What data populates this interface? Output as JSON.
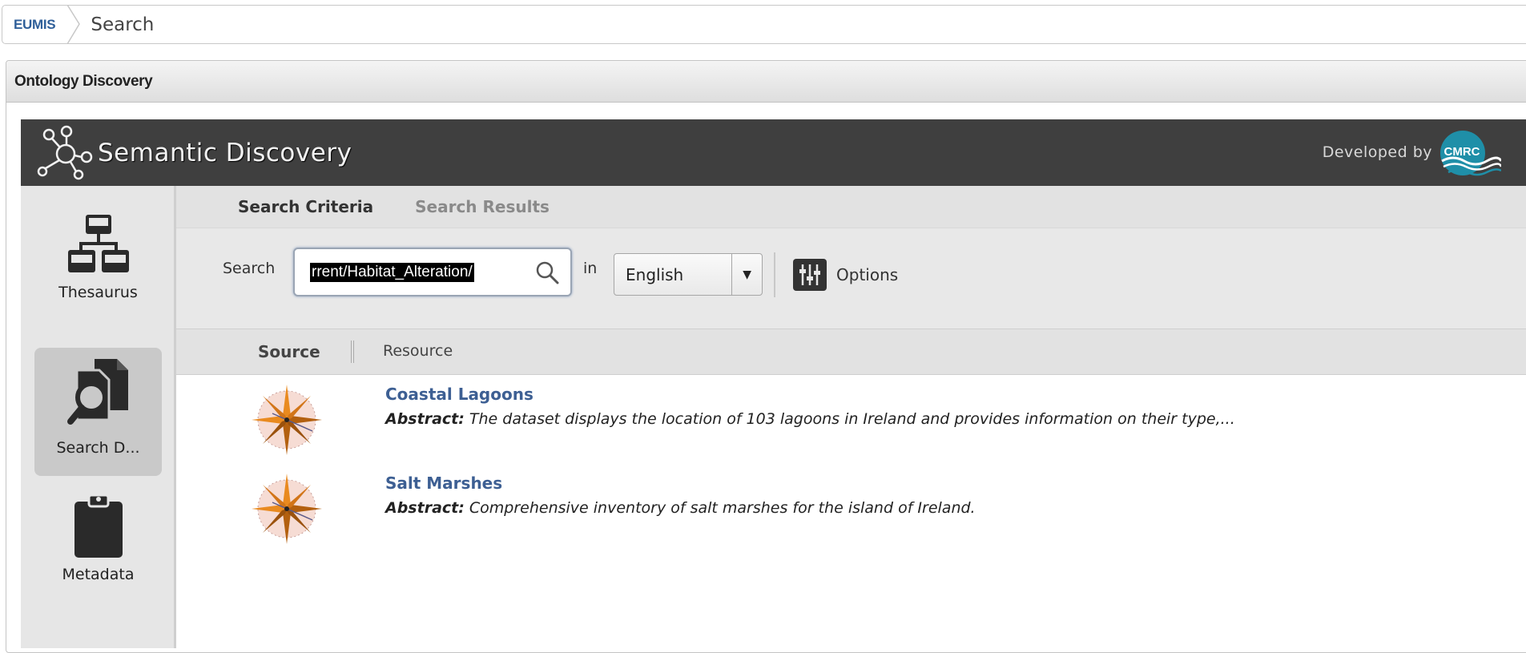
{
  "breadcrumb": {
    "home": "EUMIS",
    "current": "Search"
  },
  "panel": {
    "title": "Ontology Discovery"
  },
  "banner": {
    "title": "Semantic Discovery",
    "developed_by": "Developed by",
    "brand": "CMRC"
  },
  "sidebar": {
    "items": [
      {
        "label": "Thesaurus",
        "icon": "thesaurus-icon",
        "active": false
      },
      {
        "label": "Search D...",
        "icon": "search-documents-icon",
        "active": true
      },
      {
        "label": "Metadata",
        "icon": "clipboard-icon",
        "active": false
      }
    ]
  },
  "tabs": [
    {
      "label": "Search Criteria",
      "active": true
    },
    {
      "label": "Search Results",
      "active": false
    }
  ],
  "search": {
    "label": "Search",
    "value": "rrent/Habitat_Alteration/",
    "in_label": "in",
    "language": "English",
    "options_label": "Options"
  },
  "columns": {
    "source": "Source",
    "resource": "Resource"
  },
  "results": [
    {
      "title": "Coastal Lagoons",
      "abstract_label": "Abstract:",
      "abstract": "The dataset displays the location of 103 lagoons in Ireland and provides information on their type,..."
    },
    {
      "title": "Salt Marshes",
      "abstract_label": "Abstract:",
      "abstract": "Comprehensive inventory of salt marshes for the island of Ireland."
    }
  ],
  "colors": {
    "banner_bg": "#3f3f3f",
    "link": "#3d5f93",
    "breadcrumb_home": "#2f5f99",
    "cmrc_teal": "#1f8fa8"
  }
}
